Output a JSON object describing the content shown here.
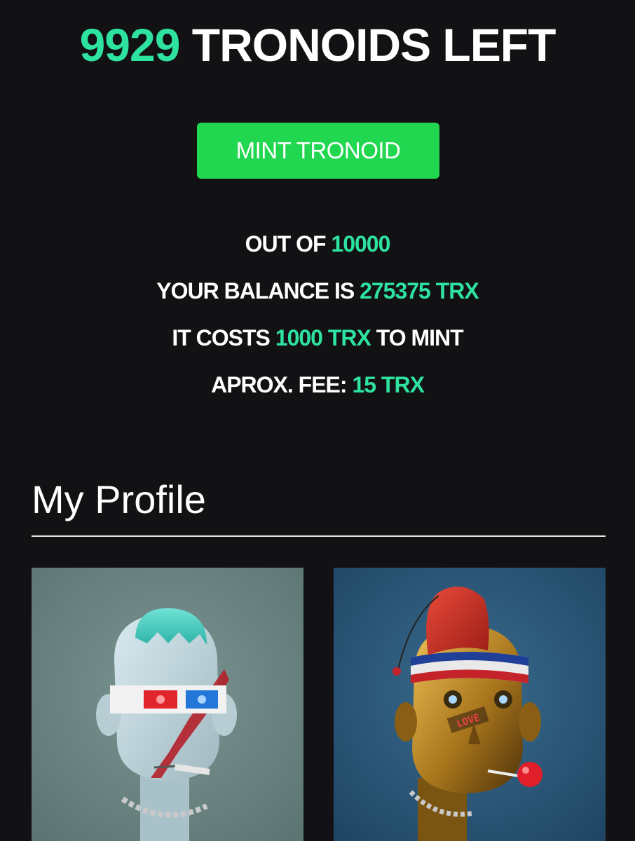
{
  "header": {
    "count": "9929",
    "label": "TRONOIDS LEFT",
    "mint_button": "MINT TRONOID"
  },
  "stats": {
    "out_of_prefix": "OUT OF",
    "out_of_value": "10000",
    "balance_prefix": "YOUR BALANCE IS",
    "balance_value": "275375 TRX",
    "cost_prefix": "IT COSTS",
    "cost_value": "1000 TRX",
    "cost_suffix": "TO MINT",
    "fee_prefix": "APROX. FEE:",
    "fee_value": "15 TRX"
  },
  "profile": {
    "title": "My Profile",
    "nfts": [
      {
        "icon": "robot-3d-glasses-icon",
        "background": "#6c8683"
      },
      {
        "icon": "robot-fez-lollipop-icon",
        "background": "#2a5473",
        "sticker": "LOVE"
      }
    ]
  },
  "colors": {
    "background": "#121214",
    "accent": "#2ee3a0",
    "button": "#22d750"
  }
}
